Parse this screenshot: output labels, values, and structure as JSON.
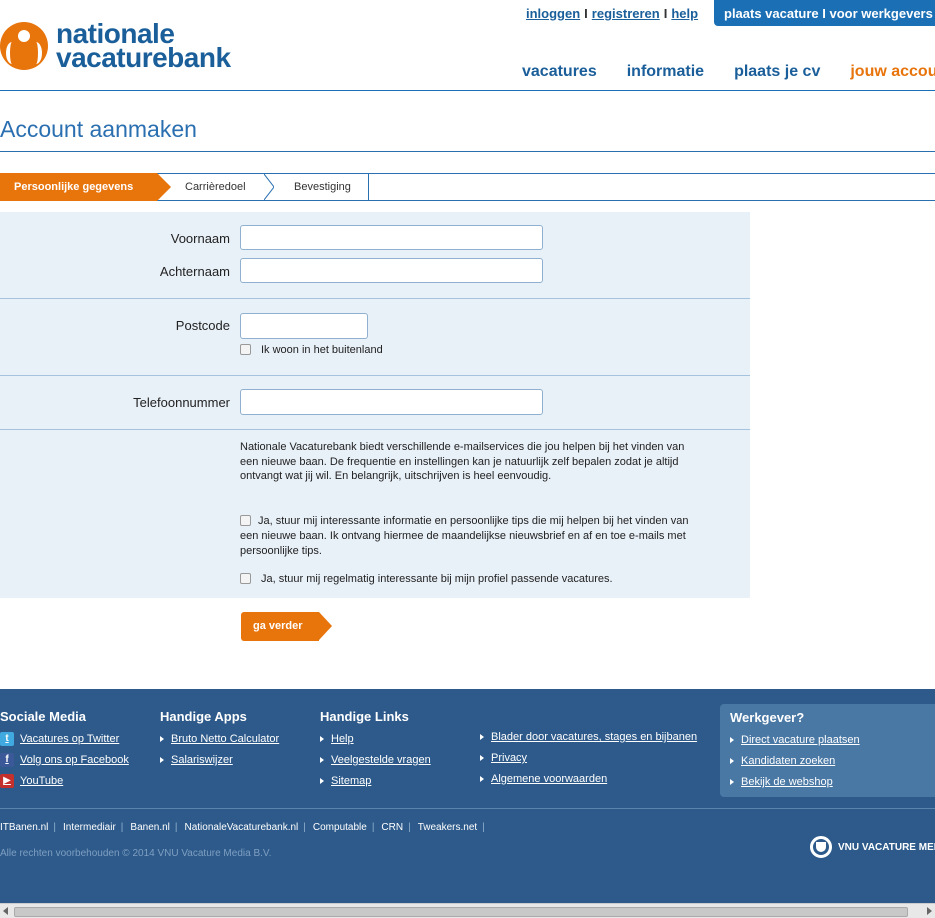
{
  "header": {
    "logo_line1": "nationale",
    "logo_line2": "vacaturebank",
    "top_links": [
      "inloggen",
      "registreren",
      "help"
    ],
    "link_separator": "I",
    "employer_button": "plaats vacature I voor werkgevers",
    "nav": [
      "vacatures",
      "informatie",
      "plaats je cv",
      "jouw accou"
    ]
  },
  "page": {
    "title": "Account aanmaken"
  },
  "steps": [
    "Persoonlijke gegevens",
    "Carrièredoel",
    "Bevestiging"
  ],
  "form": {
    "first_name_label": "Voornaam",
    "last_name_label": "Achternaam",
    "postcode_label": "Postcode",
    "abroad_label": "Ik woon in het buitenland",
    "phone_label": "Telefoonnummer",
    "info_text": "Nationale Vacaturebank biedt verschillende e-mailservices die jou helpen bij het vinden van een nieuwe baan. De frequentie en instellingen kan je natuurlijk zelf bepalen zodat je altijd ontvangt wat jij wil. En belangrijk, uitschrijven is heel eenvoudig.",
    "option_tips": "Ja, stuur mij interessante informatie en persoonlijke tips die mij helpen bij het vinden van een nieuwe baan. Ik ontvang hiermee de maandelijkse nieuwsbrief en af en toe e-mails met persoonlijke tips.",
    "option_vacancies": "Ja, stuur mij regelmatig interessante bij mijn profiel passende vacatures.",
    "submit": "ga verder"
  },
  "footer": {
    "social": {
      "title": "Sociale Media",
      "links": [
        {
          "label": "Vacatures op Twitter",
          "icon": "twitter-icon",
          "color": "#3fa9e0",
          "glyph": "t"
        },
        {
          "label": "Volg ons op Facebook",
          "icon": "facebook-icon",
          "color": "#3b5998",
          "glyph": "f"
        },
        {
          "label": "YouTube",
          "icon": "youtube-icon",
          "color": "#c4302b",
          "glyph": "▶"
        }
      ]
    },
    "apps": {
      "title": "Handige Apps",
      "links": [
        "Bruto Netto Calculator",
        "Salariswijzer"
      ]
    },
    "links": {
      "title": "Handige Links",
      "col1": [
        "Help",
        "Veelgestelde vragen",
        "Sitemap"
      ],
      "col2": [
        "Blader door vacatures, stages en bijbanen",
        "Privacy",
        "Algemene voorwaarden"
      ]
    },
    "employer": {
      "title": "Werkgever?",
      "links": [
        "Direct vacature plaatsen",
        "Kandidaten zoeken",
        "Bekijk de webshop"
      ]
    },
    "partners": [
      "ITBanen.nl",
      "Intermediair",
      "Banen.nl",
      "NationaleVacaturebank.nl",
      "Computable",
      "CRN",
      "Tweakers.net"
    ],
    "partner_separator": "|",
    "copyright": "Alle rechten voorbehouden © 2014 VNU Vacature Media B.V.",
    "vnu": "VNU VACATURE MED"
  },
  "colors": {
    "brand_blue": "#1a5e9a",
    "accent_orange": "#e8740c",
    "footer_bg": "#2d5a8a",
    "form_bg": "#e8f0f8"
  }
}
